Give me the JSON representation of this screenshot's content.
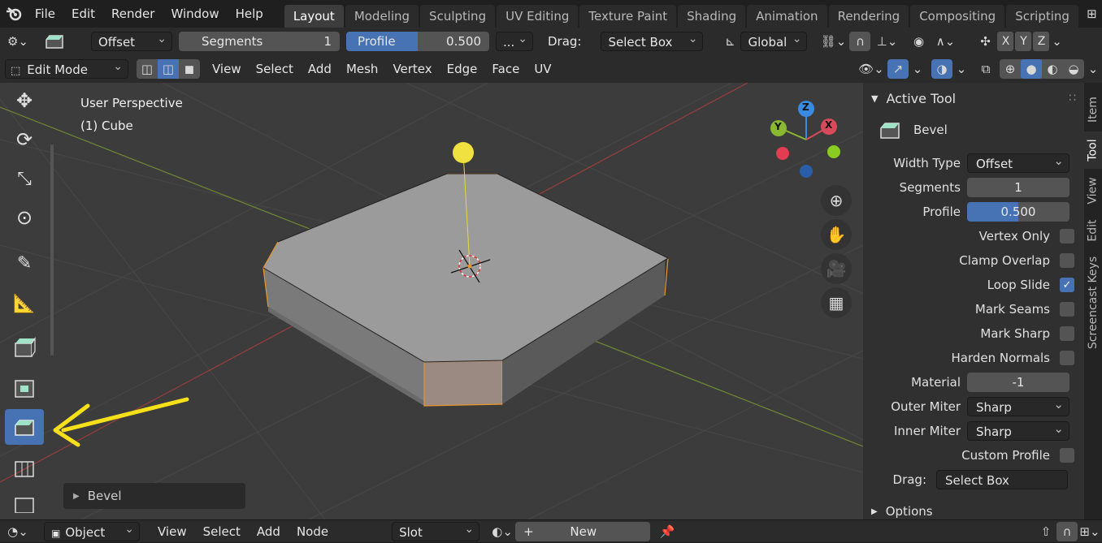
{
  "topbar": {
    "menus": [
      "File",
      "Edit",
      "Render",
      "Window",
      "Help"
    ],
    "workspaces": [
      "Layout",
      "Modeling",
      "Sculpting",
      "UV Editing",
      "Texture Paint",
      "Shading",
      "Animation",
      "Rendering",
      "Compositing",
      "Scripting"
    ],
    "active_workspace": "Layout"
  },
  "tool_header": {
    "width_type": "Offset",
    "segments_label": "Segments",
    "segments_value": "1",
    "profile_label": "Profile",
    "profile_value": "0.500",
    "more": "...",
    "drag_label": "Drag:",
    "drag_value": "Select Box",
    "orientation": "Global",
    "axis_x": "X",
    "axis_y": "Y",
    "axis_z": "Z"
  },
  "view_header": {
    "mode": "Edit Mode",
    "menus": [
      "View",
      "Select",
      "Add",
      "Mesh",
      "Vertex",
      "Edge",
      "Face",
      "UV"
    ]
  },
  "viewport": {
    "perspective": "User Perspective",
    "object": "(1) Cube",
    "operator_panel": "Bevel",
    "gizmo": {
      "x": "X",
      "y": "Y",
      "z": "Z"
    }
  },
  "npanel": {
    "section": "Active Tool",
    "tool_name": "Bevel",
    "props": [
      {
        "label": "Width Type",
        "value": "Offset",
        "kind": "select"
      },
      {
        "label": "Segments",
        "value": "1",
        "kind": "num"
      },
      {
        "label": "Profile",
        "value": "0.500",
        "kind": "slider",
        "fraction": 0.5
      }
    ],
    "checks": [
      {
        "label": "Vertex Only",
        "on": false
      },
      {
        "label": "Clamp Overlap",
        "on": false
      },
      {
        "label": "Loop Slide",
        "on": true
      },
      {
        "label": "Mark Seams",
        "on": false
      },
      {
        "label": "Mark Sharp",
        "on": false
      },
      {
        "label": "Harden Normals",
        "on": false
      }
    ],
    "material_label": "Material",
    "material_value": "-1",
    "outer_miter_label": "Outer Miter",
    "outer_miter_value": "Sharp",
    "inner_miter_label": "Inner Miter",
    "inner_miter_value": "Sharp",
    "custom_profile_label": "Custom Profile",
    "drag_label": "Drag:",
    "drag_value": "Select Box",
    "options": "Options",
    "tabs": [
      "Item",
      "Tool",
      "View",
      "Edit",
      "Screencast Keys"
    ],
    "active_tab": "Tool"
  },
  "bottombar": {
    "editor": "Object",
    "menus": [
      "View",
      "Select",
      "Add",
      "Node"
    ],
    "slot": "Slot",
    "new_label": "New"
  },
  "colors": {
    "accent": "#4772b3",
    "selected_edge": "#e8962a",
    "annotation_arrow": "#f5e01a"
  }
}
